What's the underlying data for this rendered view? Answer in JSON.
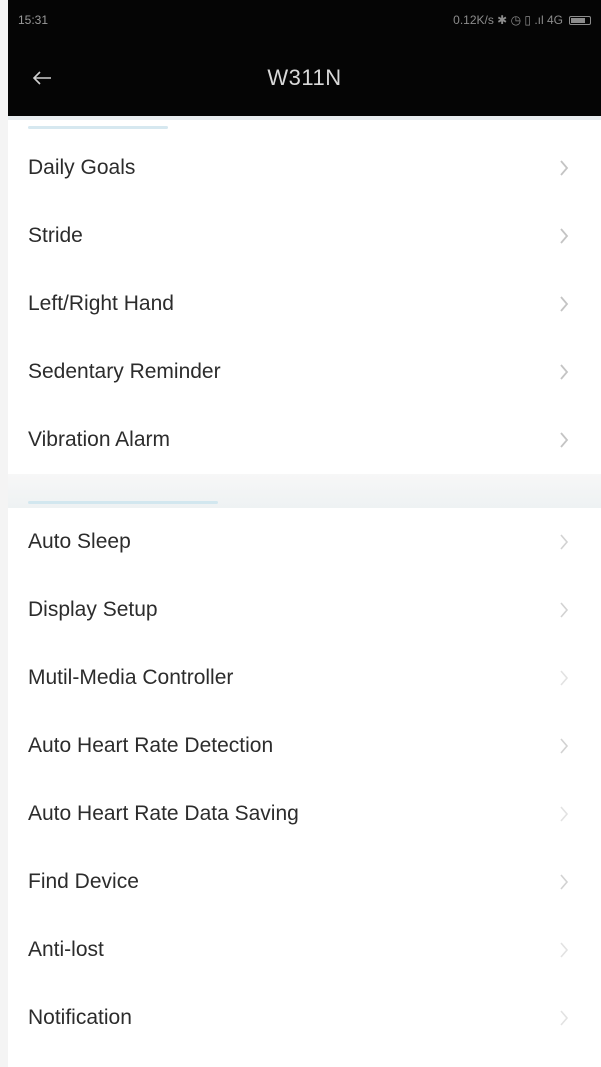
{
  "status_bar": {
    "time": "15:31",
    "indicators": "0.12K/s ✱ ◷ ▯ .ıl 4G"
  },
  "app_bar": {
    "back_icon": "back-arrow-icon",
    "title": "W311N"
  },
  "groups": [
    {
      "items": [
        {
          "label": "Daily Goals"
        },
        {
          "label": "Stride"
        },
        {
          "label": "Left/Right Hand"
        },
        {
          "label": "Sedentary Reminder"
        },
        {
          "label": "Vibration Alarm"
        }
      ]
    },
    {
      "items": [
        {
          "label": "Auto Sleep"
        },
        {
          "label": "Display Setup"
        },
        {
          "label": "Mutil-Media Controller"
        },
        {
          "label": "Auto Heart Rate Detection"
        },
        {
          "label": "Auto Heart Rate Data Saving"
        },
        {
          "label": "Find Device"
        },
        {
          "label": "Anti-lost"
        },
        {
          "label": "Notification"
        }
      ]
    }
  ],
  "colors": {
    "header_bg": "#050505",
    "row_bg": "#ffffff",
    "accent": "#d6e8f0"
  }
}
